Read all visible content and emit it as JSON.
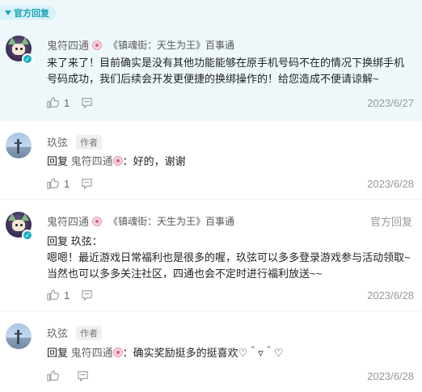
{
  "official_label": "官方回复",
  "comments": [
    {
      "user": "鬼符四通",
      "role": "《镇魂街：天生为王》百事通",
      "content": "来了来了！目前确实是没有其他功能能够在原手机号码不在的情况下换绑手机号码成功，我们后续会开发更便捷的换绑操作的！给您造成不便请谅解~",
      "likes": "1",
      "date": "2023/6/27"
    },
    {
      "user": "玖弦",
      "author_tag": "作者",
      "reply_prefix": "回复",
      "reply_target": "鬼符四通",
      "content": "：好的，谢谢",
      "likes": "1",
      "date": "2023/6/28"
    },
    {
      "user": "鬼符四通",
      "role": "《镇魂街：天生为王》百事通",
      "official_right": "官方回复",
      "reply_line": "回复 玖弦：",
      "content": "嗯嗯！最近游戏日常福利也是很多的喔，玖弦可以多多登录游戏参与活动领取~当然也可以多多关注社区，四通也会不定时进行福利放送~~",
      "likes": "1",
      "date": "2023/6/28"
    },
    {
      "user": "玖弦",
      "author_tag": "作者",
      "reply_prefix": "回复",
      "reply_target": "鬼符四通",
      "content": "：确实奖励挺多的挺喜欢♡＾▿＾♡",
      "date": "2023/6/28"
    }
  ]
}
